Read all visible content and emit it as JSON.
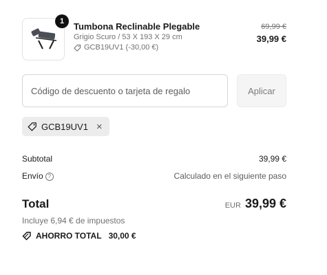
{
  "product": {
    "quantity": "1",
    "name": "Tumbona Reclinable Plegable",
    "variant": "Grigio Scuro / 53 X 193 X 29 cm",
    "discount_applied": "GCB19UV1 (-30,00 €)",
    "original_price": "69,99 €",
    "price": "39,99 €"
  },
  "discount_form": {
    "placeholder": "Código de descuento o tarjeta de regalo",
    "apply_label": "Aplicar"
  },
  "applied_code": {
    "code": "GCB19UV1",
    "remove": "×"
  },
  "summary": {
    "subtotal_label": "Subtotal",
    "subtotal_value": "39,99 €",
    "shipping_label": "Envío",
    "shipping_value": "Calculado en el siguiente paso",
    "total_label": "Total",
    "currency": "EUR",
    "total_value": "39,99 €",
    "tax_note": "Incluye 6,94 € de impuestos",
    "savings_label": "AHORRO TOTAL",
    "savings_value": "30,00 €"
  }
}
